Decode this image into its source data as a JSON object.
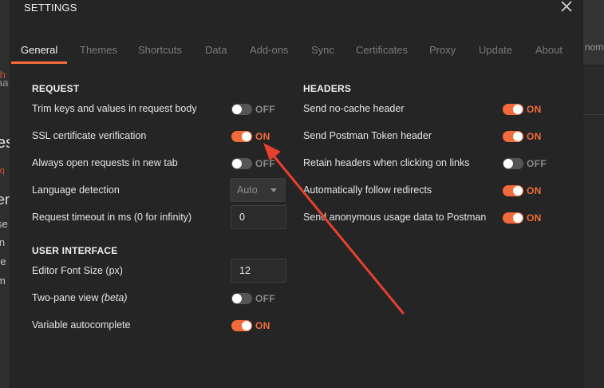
{
  "background": {
    "left_fragments": [
      "aa",
      "th",
      "es",
      "rq",
      "en",
      "se",
      "in",
      "re",
      "m"
    ],
    "right_fragment": "nome"
  },
  "modal": {
    "title": "SETTINGS",
    "close_icon": "close-icon"
  },
  "tabs": [
    {
      "label": "General",
      "active": true
    },
    {
      "label": "Themes"
    },
    {
      "label": "Shortcuts"
    },
    {
      "label": "Data"
    },
    {
      "label": "Add-ons"
    },
    {
      "label": "Sync"
    },
    {
      "label": "Certificates"
    },
    {
      "label": "Proxy"
    },
    {
      "label": "Update"
    },
    {
      "label": "About"
    }
  ],
  "request": {
    "title": "REQUEST",
    "trim_keys": {
      "label": "Trim keys and values in request body",
      "state": "OFF"
    },
    "ssl_verification": {
      "label": "SSL certificate verification",
      "state": "ON"
    },
    "open_new_tab": {
      "label": "Always open requests in new tab",
      "state": "OFF"
    },
    "language_detection": {
      "label": "Language detection",
      "value": "Auto"
    },
    "timeout": {
      "label": "Request timeout in ms (0 for infinity)",
      "value": "0"
    }
  },
  "user_interface": {
    "title": "USER INTERFACE",
    "editor_font_size": {
      "label": "Editor Font Size (px)",
      "value": "12"
    },
    "two_pane": {
      "label": "Two-pane view",
      "label_suffix": "(beta)",
      "state": "OFF"
    },
    "variable_autocomplete": {
      "label": "Variable autocomplete",
      "state": "ON"
    }
  },
  "headers": {
    "title": "HEADERS",
    "no_cache": {
      "label": "Send no-cache header",
      "state": "ON"
    },
    "postman_token": {
      "label": "Send Postman Token header",
      "state": "ON"
    },
    "retain_headers": {
      "label": "Retain headers when clicking on links",
      "state": "OFF"
    },
    "follow_redirects": {
      "label": "Automatically follow redirects",
      "state": "ON"
    },
    "usage_data": {
      "label": "Send anonymous usage data to Postman",
      "state": "ON"
    }
  },
  "colors": {
    "accent": "#f26b3a",
    "annotation_arrow": "#e8402e",
    "modal_background": "#252525",
    "toggle_off": "#555555"
  }
}
